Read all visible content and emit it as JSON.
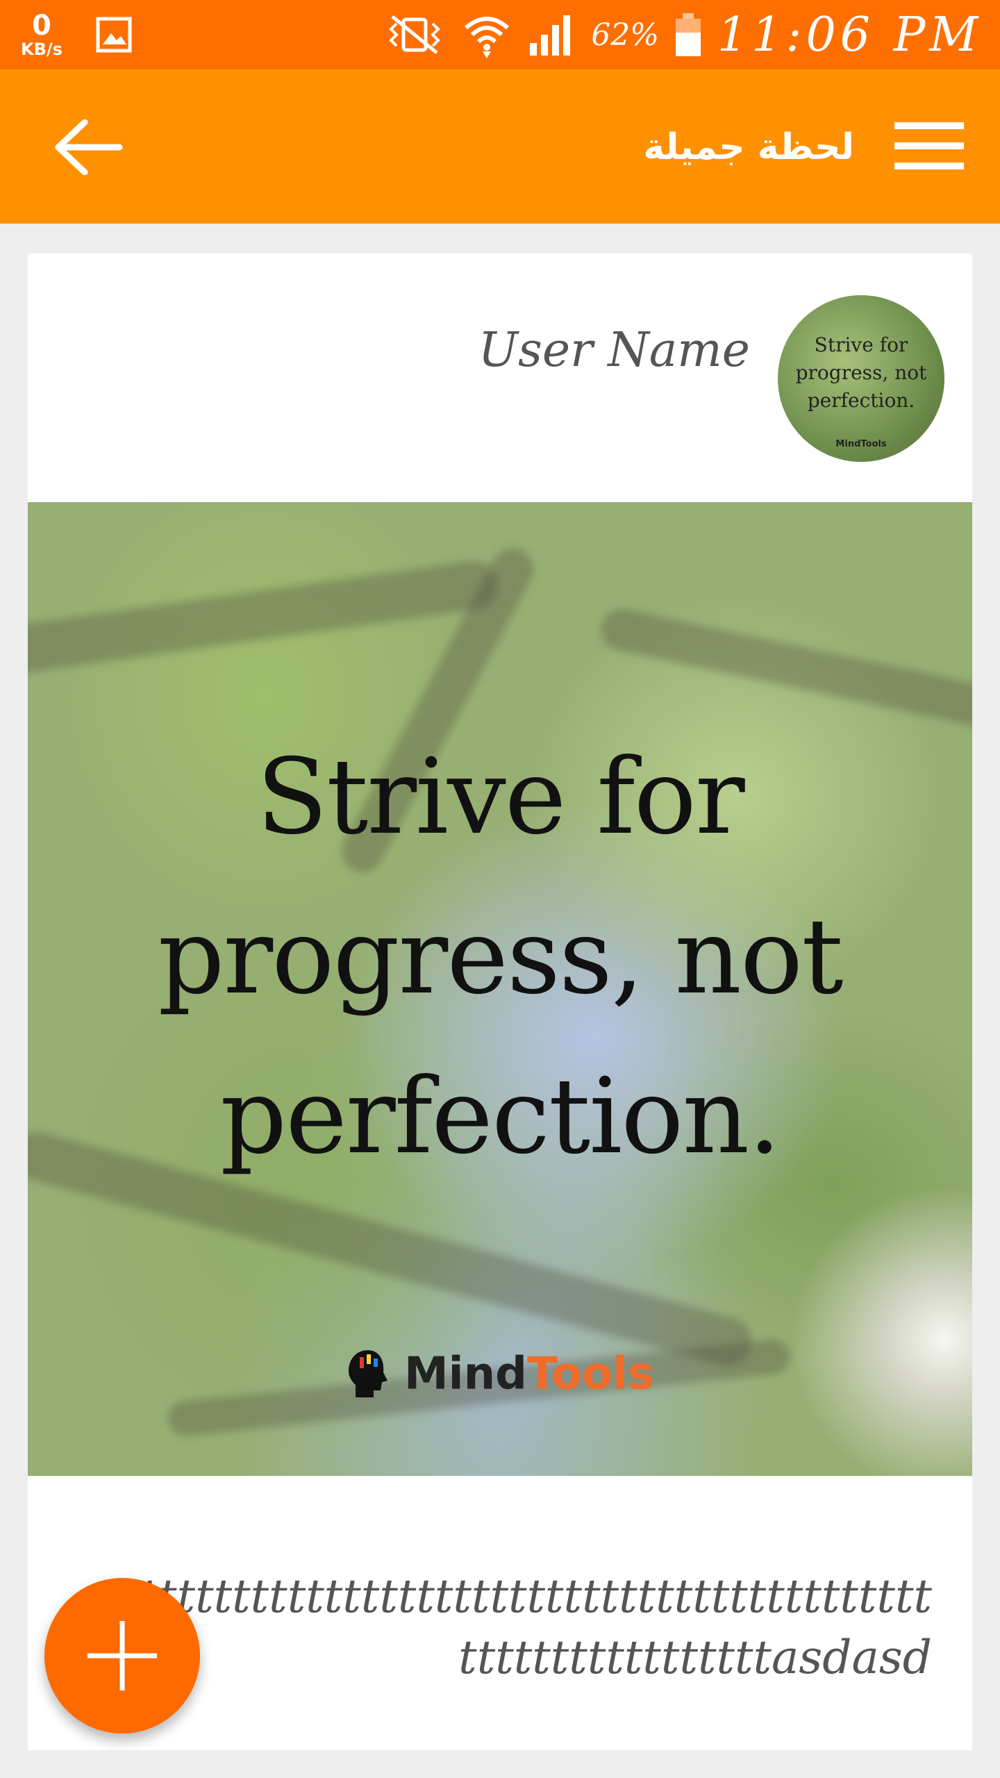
{
  "status_bar": {
    "net_speed_value": "0",
    "net_speed_unit": "KB/s",
    "battery_percent": "62%",
    "time": "11:06 PM",
    "color": "#ff6f00"
  },
  "app_bar": {
    "title": "لحظة جميلة",
    "color": "#ff9100",
    "back_icon": "arrow-back-icon",
    "menu_icon": "hamburger-menu-icon"
  },
  "post": {
    "user_name": "User Name",
    "avatar_text": "Strive for progress, not perfection.",
    "avatar_brand": "MindTools",
    "image_quote_lines": [
      "Strive for",
      "progress, not",
      "perfection."
    ],
    "image_brand_mind": "Mind",
    "image_brand_tools": "Tools",
    "text": "ttttttttttttttttttttttttttttttttttttttttttttttttttttttttttttttasdasd"
  },
  "fab": {
    "icon": "plus-icon",
    "color": "#ff6a00"
  }
}
